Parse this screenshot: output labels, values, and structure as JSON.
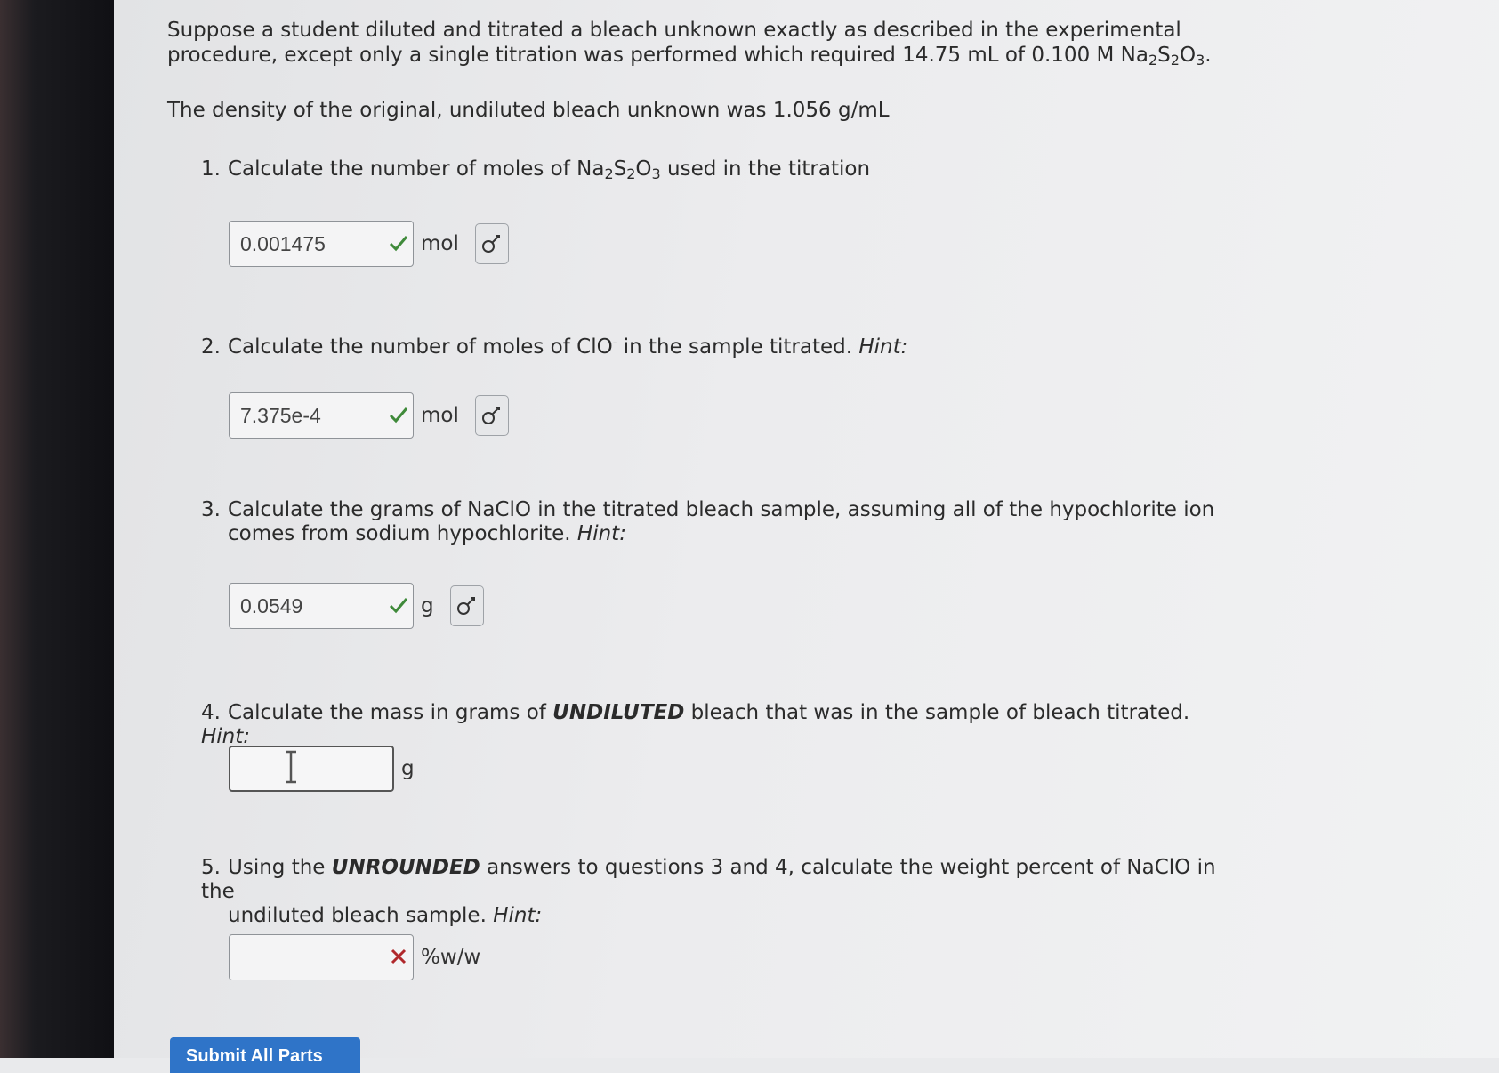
{
  "intro": {
    "p1_a": "Suppose a student diluted and titrated a bleach unknown exactly as described in the experimental procedure, except only a single titration was performed which required 14.75 mL of 0.100 M Na",
    "p1_sub1": "2",
    "p1_s": "S",
    "p1_sub2": "2",
    "p1_o": "O",
    "p1_sub3": "3",
    "p1_end": ".",
    "p2": "The density of the original, undiluted bleach unknown was 1.056 g/mL"
  },
  "questions": [
    {
      "number": "1.",
      "text_a": "Calculate the number of moles of Na",
      "sub1": "2",
      "s": "S",
      "sub2": "2",
      "o": "O",
      "sub3": "3",
      "text_b": " used in the titration",
      "answer": "0.001475",
      "unit": "mol",
      "status": "correct"
    },
    {
      "number": "2.",
      "text_a": "Calculate the number of moles of ClO",
      "sup": "-",
      "text_b": " in the sample titrated. ",
      "hint": "Hint:",
      "answer": "7.375e-4",
      "unit": "mol",
      "status": "correct"
    },
    {
      "number": "3.",
      "text": "Calculate the grams of NaClO in the titrated bleach sample, assuming all of the hypochlorite ion",
      "text_cont": "comes from sodium hypochlorite. ",
      "hint": "Hint:",
      "answer": "0.0549",
      "unit": "g",
      "status": "correct"
    },
    {
      "number": "4.",
      "text_a": "Calculate the mass in grams of ",
      "emph": "UNDILUTED",
      "text_b": " bleach that was in the sample of bleach titrated. ",
      "hint": "Hint:",
      "answer": "",
      "unit": "g",
      "status": "active"
    },
    {
      "number": "5.",
      "text_a": "Using the ",
      "emph": "UNROUNDED",
      "text_b": " answers to questions 3 and 4, calculate the weight percent of NaClO in the",
      "text_cont": "undiluted bleach sample. ",
      "hint": "Hint:",
      "answer": "",
      "unit": "%w/w",
      "status": "incorrect"
    }
  ],
  "submit_label": "Submit All Parts",
  "colors": {
    "correct": "#3f8a3a",
    "incorrect": "#b0282c",
    "submit": "#2f74c8"
  },
  "icons": {
    "correct_mark": "check-icon",
    "incorrect_mark": "x-icon",
    "key_button": "key-icon"
  }
}
